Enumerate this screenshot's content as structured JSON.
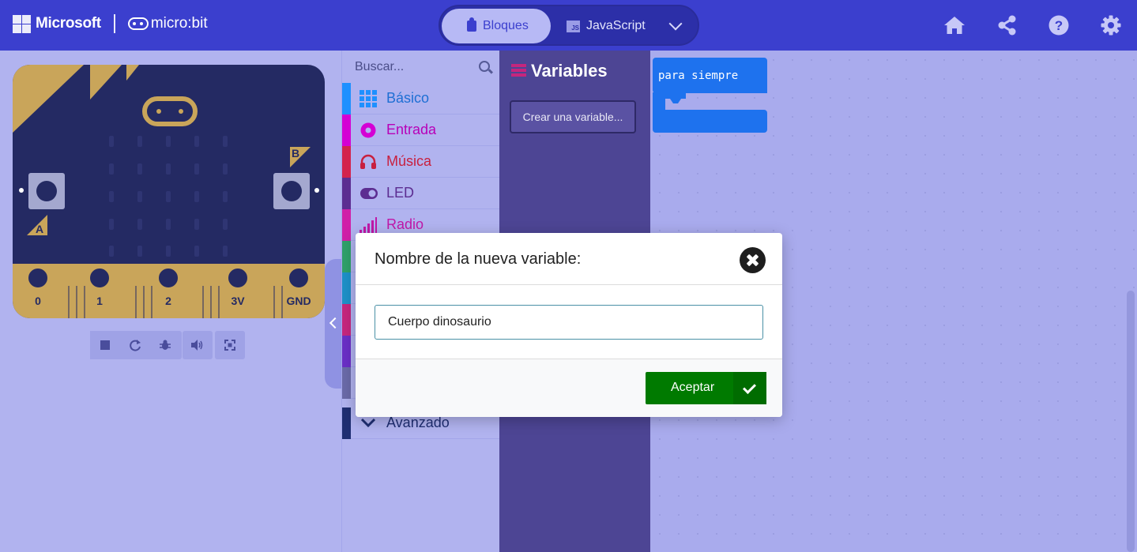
{
  "header": {
    "brand": "Microsoft",
    "product": "micro:bit",
    "modes": {
      "blocks": "Bloques",
      "javascript": "JavaScript",
      "blocks_icon": "puzzle-icon",
      "js_icon_text": "JS"
    },
    "icons": [
      "home-icon",
      "share-icon",
      "help-icon",
      "settings-icon"
    ],
    "help_glyph": "?"
  },
  "simulator": {
    "button_a": "A",
    "button_b": "B",
    "pins": [
      "0",
      "1",
      "2",
      "3V",
      "GND"
    ],
    "controls": [
      "stop-icon",
      "restart-icon",
      "debug-icon",
      "mute-icon",
      "fullscreen-icon"
    ]
  },
  "toolbox": {
    "search_placeholder": "Buscar...",
    "categories": [
      {
        "label": "Básico",
        "color": "#1e90ff",
        "icon": "grid-icon"
      },
      {
        "label": "Entrada",
        "color": "#d400d4",
        "icon": "radio-target-icon"
      },
      {
        "label": "Música",
        "color": "#e63022",
        "icon": "headphones-icon"
      },
      {
        "label": "LED",
        "color": "#5c2d91",
        "icon": "toggle-icon"
      },
      {
        "label": "Radio",
        "color": "#e3008c",
        "icon": "signal-icon"
      }
    ],
    "hidden_category_colors": [
      "#00a4a6",
      "#1e90ff",
      "#c5267d",
      "#5c2d91",
      "#6a6a8f"
    ],
    "advanced_label": "Avanzado"
  },
  "flyout": {
    "title": "Variables",
    "create_variable": "Crear una variable..."
  },
  "workspace": {
    "forever_block": "para siempre",
    "block_color": "#1e72ee"
  },
  "dialog": {
    "title": "Nombre de la nueva variable:",
    "input_value": "Cuerpo dinosaurio",
    "accept": "Aceptar"
  },
  "colors": {
    "header": "#3b3fce",
    "accent_green": "#007a00",
    "variables": "#4d4594"
  }
}
